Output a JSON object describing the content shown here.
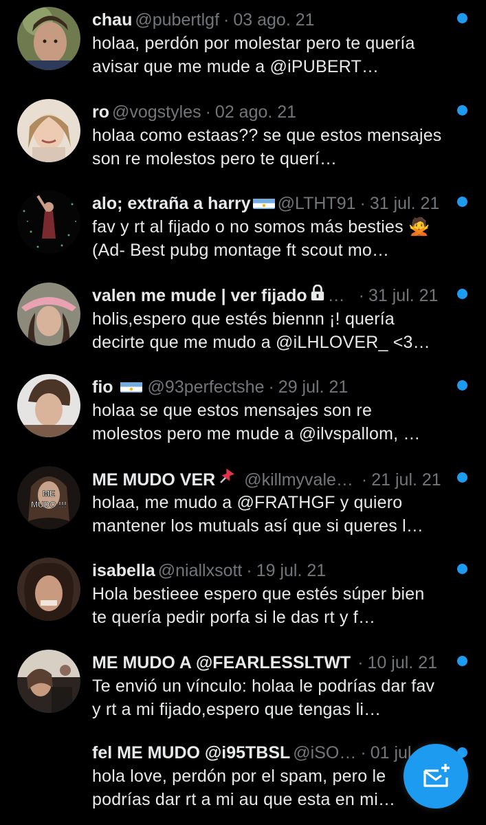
{
  "messages": [
    {
      "name": "chau",
      "handle": "@pubertlgf",
      "date": "03 ago. 21",
      "text": "holaa, perdón por molestar pero te quería avisar que me mude a @iPUBERT…",
      "unread": true
    },
    {
      "name": "ro",
      "handle": "@vogstyles",
      "date": "02 ago. 21",
      "text": "holaa como estaas?? se que estos mensajes son re molestos pero te querí…",
      "unread": true
    },
    {
      "name": "alo; extraña a harry",
      "handle": "@LTHT91",
      "date": "31 jul. 21",
      "text": "fav y rt al fijado o no somos más besties 🙅 (Ad- Best pubg montage ft scout mo…",
      "unread": true
    },
    {
      "name": "valen me mude | ver fijado",
      "handle": "…",
      "date": "31 jul. 21",
      "text": "holis,espero que estés biennn ¡! quería decirte que me mudo a @iLHLOVER_ <3…",
      "unread": true
    },
    {
      "name": "fio",
      "handle": "@93perfectshe",
      "date": "29 jul. 21",
      "text": "holaa se que estos mensajes son re molestos pero me mude a @ilvspallom, …",
      "unread": true
    },
    {
      "name": "ME MUDO VER",
      "handle": "@killmyvale…",
      "date": "21 jul. 21",
      "text": "holaa, me mudo a @FRATHGF y quiero mantener los mutuals así que si queres l…",
      "unread": true
    },
    {
      "name": "isabella",
      "handle": "@niallxsott",
      "date": "19 jul. 21",
      "text": "Hola bestieee espero que estés súper bien te quería pedir porfa si le das rt y f…",
      "unread": true
    },
    {
      "name": "ME MUDO A @FEARLESSLTWT",
      "handle": "",
      "date": "10 jul. 21",
      "text": "Te envió un vínculo: holaa le podrías dar fav y rt a mi fijado,espero que tengas li…",
      "unread": true
    },
    {
      "name": "fel ME MUDO @i95TBSL",
      "handle": "@iSO…",
      "date": "01 jul.",
      "text": "hola love, perdón por el spam, pero le podrías dar rt a mi au que esta en mi…",
      "unread": true
    }
  ],
  "avatar_texts": {
    "me_mudo": "ME MUDO !!!"
  },
  "colors": {
    "accent": "#1d9bf0",
    "muted": "#71767b",
    "text": "#e7e9ea",
    "bg": "#000000"
  },
  "fab": {
    "icon": "new-message-icon"
  }
}
